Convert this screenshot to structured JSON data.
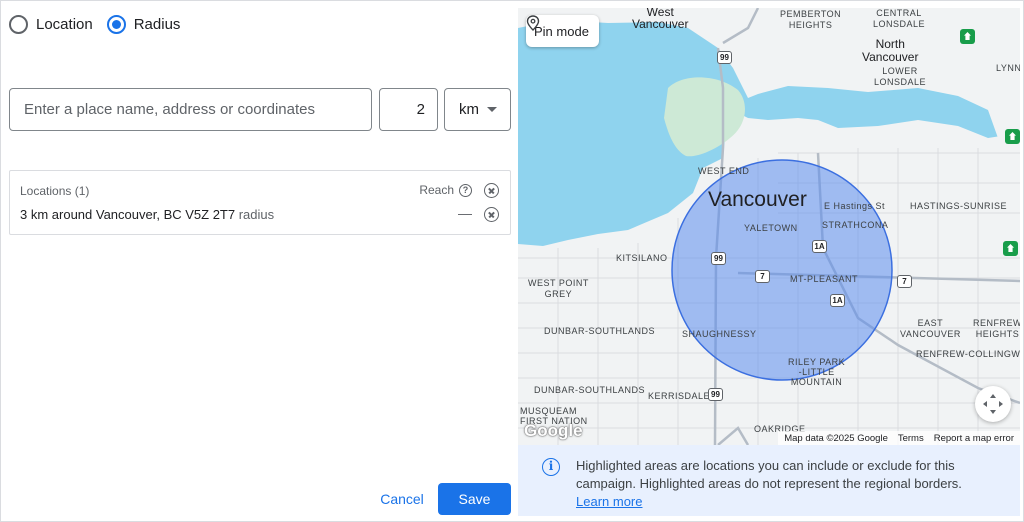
{
  "mode": {
    "options": [
      {
        "label": "Location",
        "selected": false
      },
      {
        "label": "Radius",
        "selected": true
      }
    ]
  },
  "search": {
    "placeholder": "Enter a place name, address or coordinates",
    "value": "",
    "radius_value": "2",
    "unit": "km"
  },
  "locations": {
    "header": "Locations (1)",
    "reach_label": "Reach",
    "reach_help_icon": "help-circle-icon",
    "items": [
      {
        "name": "3 km around Vancouver, BC V5Z 2T7",
        "suffix": "radius",
        "reach": "—"
      }
    ]
  },
  "actions": {
    "cancel_label": "Cancel",
    "save_label": "Save"
  },
  "map": {
    "pin_mode_label": "Pin mode",
    "labels": {
      "west_vancouver": "West\nVancouver",
      "pemberton_heights": "PEMBERTON\nHEIGHTS",
      "central_lonsdale": "CENTRAL\nLONSDALE",
      "north_vancouver": "North\nVancouver",
      "lower_lonsdale": "LOWER\nLONSDALE",
      "lynn": "LYNN",
      "west_end": "WEST END",
      "vancouver": "Vancouver",
      "e_hastings": "E Hastings St",
      "strathcona": "STRATHCONA",
      "yaletown": "YALETOWN",
      "hastings_sunrise": "HASTINGS-SUNRISE",
      "kitsilano": "KITSILANO",
      "mt_pleasant": "MT-PLEASANT",
      "west_point_grey": "WEST POINT\nGREY",
      "dunbar_southlands_1": "DUNBAR-SOUTHLANDS",
      "shaughnessy": "SHAUGHNESSY",
      "east_vancouver": "EAST\nVANCOUVER",
      "renfrew_heights": "RENFREW\nHEIGHTS",
      "renfrew_collingwood": "RENFREW-COLLINGWOOD",
      "riley_park": "RILEY PARK\n-LITTLE\nMOUNTAIN",
      "dunbar_southlands_2": "DUNBAR-SOUTHLANDS",
      "kerrisdale": "KERRISDALE",
      "musqueam": "MUSQUEAM\nFIRST NATION",
      "oakridge": "OAKRIDGE"
    },
    "shields": {
      "hwy99_north": "99",
      "hwy99_mid": "99",
      "hwy99_south": "99",
      "hwy1a_east": "1A",
      "hwy1a_south": "1A",
      "hwy7_west": "7",
      "hwy7_east": "7"
    },
    "google_logo": "Google",
    "attribution": {
      "map_data": "Map data ©2025 Google",
      "terms": "Terms",
      "report": "Report a map error"
    },
    "colors": {
      "water": "#8fd3ee",
      "land": "#f1f3f4",
      "park": "#cde9d6",
      "radius_fill": "#5b8def",
      "radius_stroke": "#3b6fe0"
    },
    "radius_circle_icon": "radius-circle",
    "recenter_icon": "recenter-icon"
  },
  "info": {
    "icon": "info-icon",
    "text": "Highlighted areas are locations you can include or exclude for this campaign. Highlighted areas do not represent the regional borders.",
    "link": "Learn more"
  }
}
